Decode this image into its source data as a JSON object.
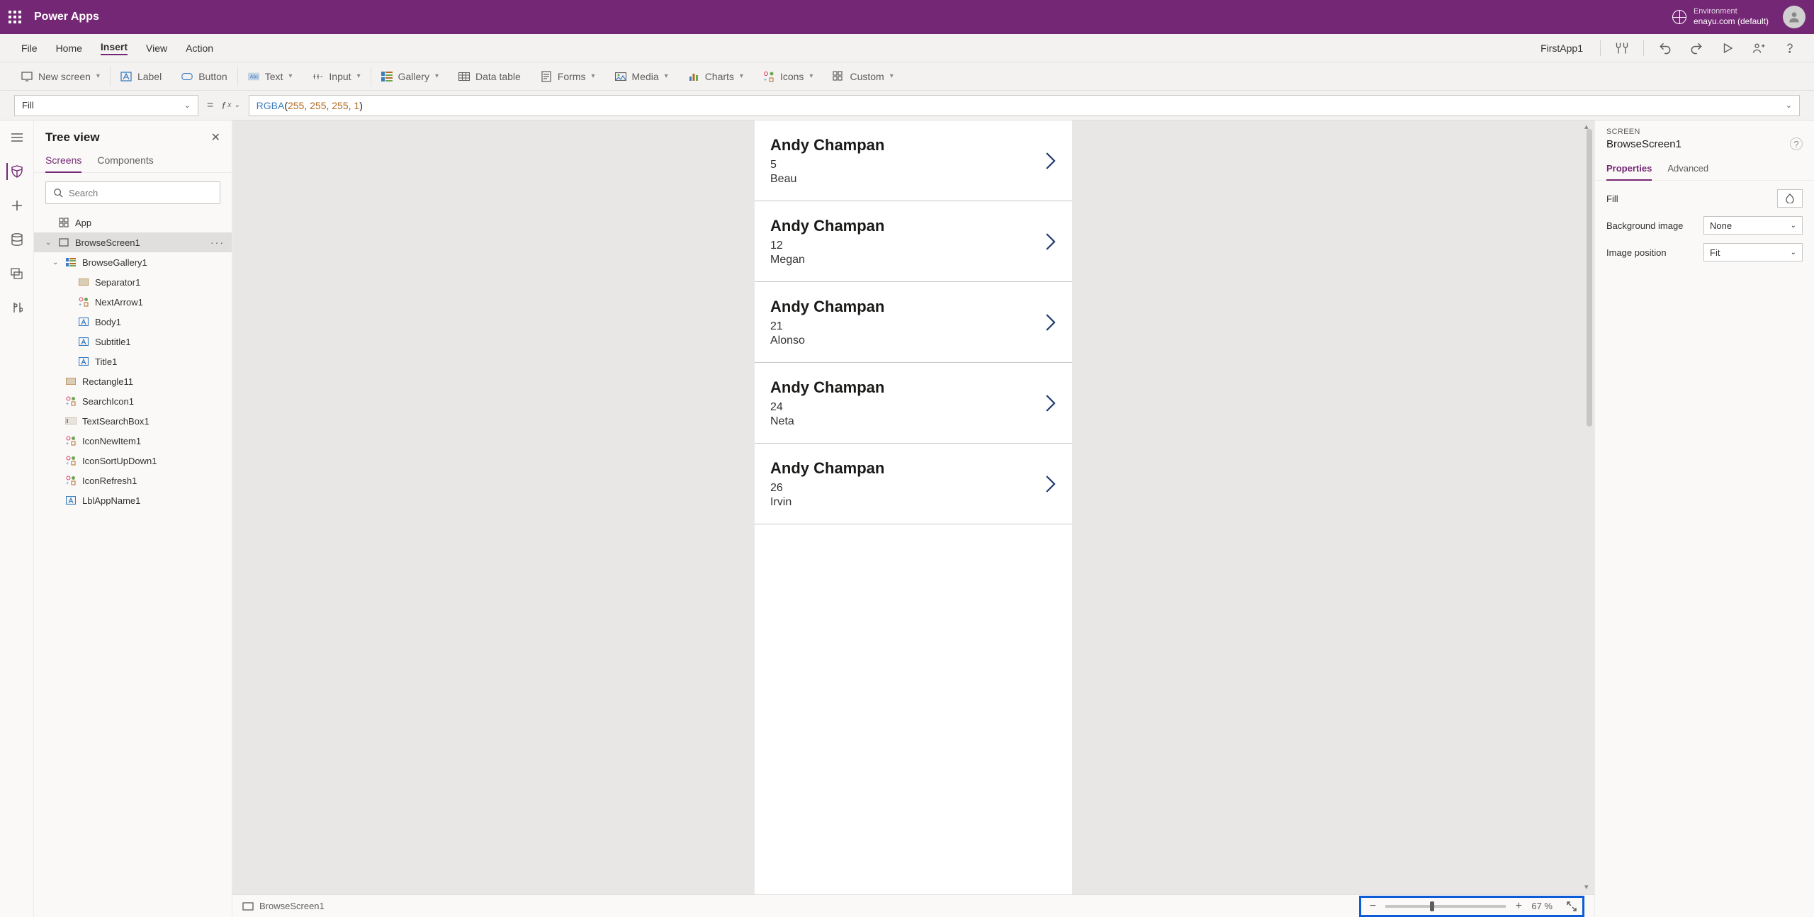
{
  "header": {
    "appTitle": "Power Apps",
    "envLabel": "Environment",
    "envName": "enayu.com (default)"
  },
  "menubar": {
    "items": [
      "File",
      "Home",
      "Insert",
      "View",
      "Action"
    ],
    "activeIndex": 2,
    "appName": "FirstApp1"
  },
  "ribbon": {
    "newScreen": "New screen",
    "label": "Label",
    "button": "Button",
    "text": "Text",
    "input": "Input",
    "gallery": "Gallery",
    "dataTable": "Data table",
    "forms": "Forms",
    "media": "Media",
    "charts": "Charts",
    "icons": "Icons",
    "custom": "Custom"
  },
  "formula": {
    "property": "Fill",
    "fn": "RGBA",
    "args": [
      "255",
      "255",
      "255",
      "1"
    ]
  },
  "tree": {
    "title": "Tree view",
    "tabs": [
      "Screens",
      "Components"
    ],
    "activeTab": 0,
    "searchPlaceholder": "Search",
    "items": [
      {
        "label": "App",
        "depth": 0,
        "icon": "app"
      },
      {
        "label": "BrowseScreen1",
        "depth": 0,
        "icon": "screen",
        "expanded": true,
        "selected": true,
        "more": true
      },
      {
        "label": "BrowseGallery1",
        "depth": 1,
        "icon": "gallery",
        "expanded": true
      },
      {
        "label": "Separator1",
        "depth": 2,
        "icon": "rect"
      },
      {
        "label": "NextArrow1",
        "depth": 2,
        "icon": "icons"
      },
      {
        "label": "Body1",
        "depth": 2,
        "icon": "label"
      },
      {
        "label": "Subtitle1",
        "depth": 2,
        "icon": "label"
      },
      {
        "label": "Title1",
        "depth": 2,
        "icon": "label"
      },
      {
        "label": "Rectangle11",
        "depth": 1,
        "icon": "rect"
      },
      {
        "label": "SearchIcon1",
        "depth": 1,
        "icon": "icons"
      },
      {
        "label": "TextSearchBox1",
        "depth": 1,
        "icon": "textinput"
      },
      {
        "label": "IconNewItem1",
        "depth": 1,
        "icon": "icons"
      },
      {
        "label": "IconSortUpDown1",
        "depth": 1,
        "icon": "icons"
      },
      {
        "label": "IconRefresh1",
        "depth": 1,
        "icon": "icons"
      },
      {
        "label": "LblAppName1",
        "depth": 1,
        "icon": "label"
      }
    ]
  },
  "canvas": {
    "items": [
      {
        "title": "Andy Champan",
        "num": "5",
        "sub": "Beau"
      },
      {
        "title": "Andy Champan",
        "num": "12",
        "sub": "Megan"
      },
      {
        "title": "Andy Champan",
        "num": "21",
        "sub": "Alonso"
      },
      {
        "title": "Andy Champan",
        "num": "24",
        "sub": "Neta"
      },
      {
        "title": "Andy Champan",
        "num": "26",
        "sub": "Irvin"
      }
    ]
  },
  "status": {
    "screenName": "BrowseScreen1",
    "zoom": "67  %"
  },
  "props": {
    "typeLabel": "SCREEN",
    "name": "BrowseScreen1",
    "tabs": [
      "Properties",
      "Advanced"
    ],
    "activeTab": 0,
    "fillLabel": "Fill",
    "bgImageLabel": "Background image",
    "bgImageValue": "None",
    "imgPosLabel": "Image position",
    "imgPosValue": "Fit"
  }
}
